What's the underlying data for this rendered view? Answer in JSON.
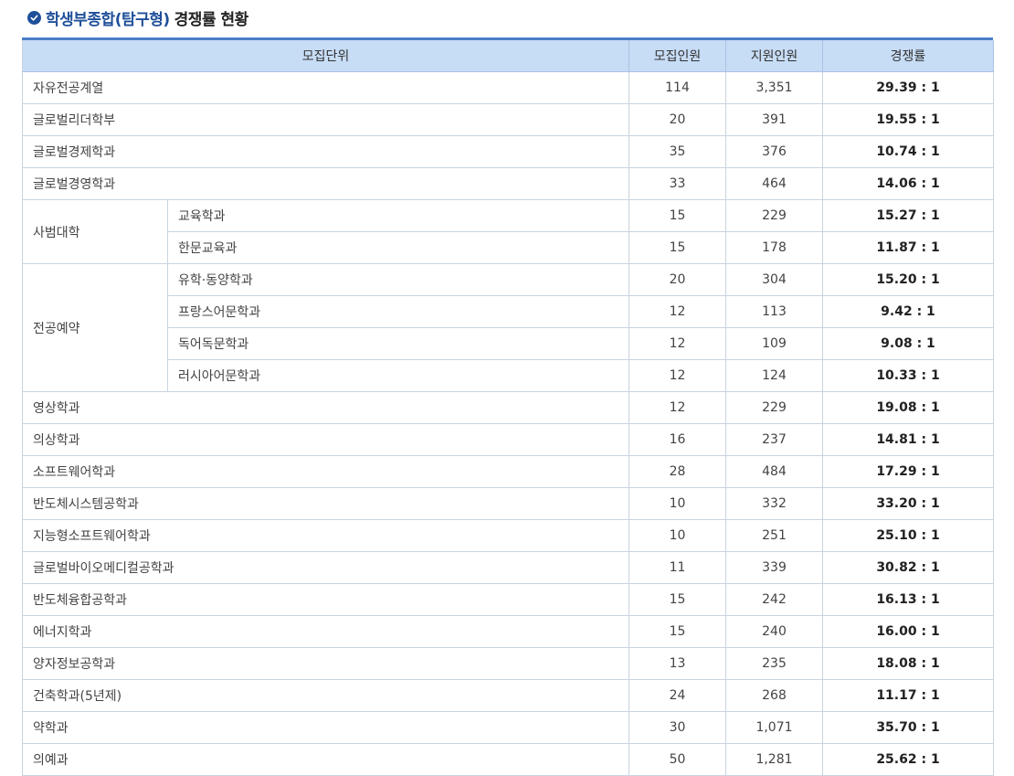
{
  "title": {
    "highlight": "학생부종합(탐구형)",
    "rest": "경쟁률 현황"
  },
  "headers": {
    "unit": "모집단위",
    "quota": "모집인원",
    "applicants": "지원인원",
    "rate": "경쟁률"
  },
  "rows": [
    {
      "unit": "자유전공계열",
      "quota": "114",
      "applicants": "3,351",
      "rate": "29.39 : 1"
    },
    {
      "unit": "글로벌리더학부",
      "quota": "20",
      "applicants": "391",
      "rate": "19.55 : 1"
    },
    {
      "unit": "글로벌경제학과",
      "quota": "35",
      "applicants": "376",
      "rate": "10.74 : 1"
    },
    {
      "unit": "글로벌경영학과",
      "quota": "33",
      "applicants": "464",
      "rate": "14.06 : 1"
    },
    {
      "group": "사범대학",
      "unit": "교육학과",
      "quota": "15",
      "applicants": "229",
      "rate": "15.27 : 1"
    },
    {
      "unit": "한문교육과",
      "quota": "15",
      "applicants": "178",
      "rate": "11.87 : 1"
    },
    {
      "group": "전공예약",
      "unit": "유학·동양학과",
      "quota": "20",
      "applicants": "304",
      "rate": "15.20 : 1"
    },
    {
      "unit": "프랑스어문학과",
      "quota": "12",
      "applicants": "113",
      "rate": "9.42 : 1"
    },
    {
      "unit": "독어독문학과",
      "quota": "12",
      "applicants": "109",
      "rate": "9.08 : 1"
    },
    {
      "unit": "러시아어문학과",
      "quota": "12",
      "applicants": "124",
      "rate": "10.33 : 1"
    },
    {
      "unit": "영상학과",
      "quota": "12",
      "applicants": "229",
      "rate": "19.08 : 1"
    },
    {
      "unit": "의상학과",
      "quota": "16",
      "applicants": "237",
      "rate": "14.81 : 1"
    },
    {
      "unit": "소프트웨어학과",
      "quota": "28",
      "applicants": "484",
      "rate": "17.29 : 1"
    },
    {
      "unit": "반도체시스템공학과",
      "quota": "10",
      "applicants": "332",
      "rate": "33.20 : 1"
    },
    {
      "unit": "지능형소프트웨어학과",
      "quota": "10",
      "applicants": "251",
      "rate": "25.10 : 1"
    },
    {
      "unit": "글로벌바이오메디컬공학과",
      "quota": "11",
      "applicants": "339",
      "rate": "30.82 : 1"
    },
    {
      "unit": "반도체융합공학과",
      "quota": "15",
      "applicants": "242",
      "rate": "16.13 : 1"
    },
    {
      "unit": "에너지학과",
      "quota": "15",
      "applicants": "240",
      "rate": "16.00 : 1"
    },
    {
      "unit": "양자정보공학과",
      "quota": "13",
      "applicants": "235",
      "rate": "18.08 : 1"
    },
    {
      "unit": "건축학과(5년제)",
      "quota": "24",
      "applicants": "268",
      "rate": "11.17 : 1"
    },
    {
      "unit": "약학과",
      "quota": "30",
      "applicants": "1,071",
      "rate": "35.70 : 1"
    },
    {
      "unit": "의예과",
      "quota": "50",
      "applicants": "1,281",
      "rate": "25.62 : 1"
    }
  ],
  "colors": {
    "accent": "#1f4f99",
    "header_bg": "#c7dcf5",
    "top_border": "#4a7fc8"
  },
  "icons": {
    "title": "check-circle-icon"
  }
}
